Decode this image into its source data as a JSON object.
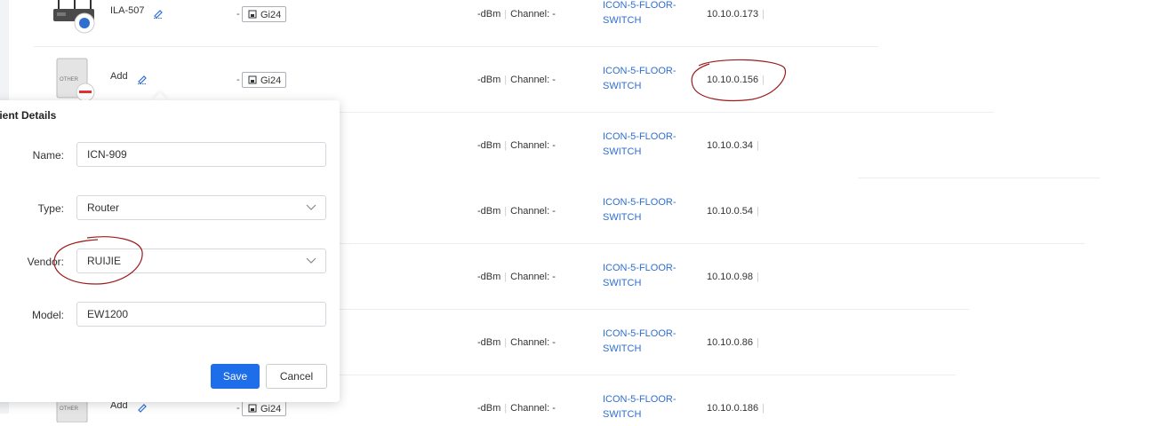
{
  "rows": [
    {
      "device_type": "router",
      "name": "ILA-507",
      "port": "Gi24",
      "signal": "-dBm",
      "channel": "Channel: -",
      "switch": "ICON-5-FLOOR-SWITCH",
      "ip": "10.10.0.173"
    },
    {
      "device_type": "other",
      "device_label": "OTHER",
      "name": "Add",
      "port": "Gi24",
      "signal": "-dBm",
      "channel": "Channel: -",
      "switch": "ICON-5-FLOOR-SWITCH",
      "ip": "10.10.0.156"
    },
    {
      "signal": "-dBm",
      "channel": "Channel: -",
      "switch": "ICON-5-FLOOR-SWITCH",
      "ip": "10.10.0.34"
    },
    {
      "signal": "-dBm",
      "channel": "Channel: -",
      "switch": "ICON-5-FLOOR-SWITCH",
      "ip": "10.10.0.54"
    },
    {
      "signal": "-dBm",
      "channel": "Channel: -",
      "switch": "ICON-5-FLOOR-SWITCH",
      "ip": "10.10.0.98"
    },
    {
      "signal": "-dBm",
      "channel": "Channel: -",
      "switch": "ICON-5-FLOOR-SWITCH",
      "ip": "10.10.0.86"
    },
    {
      "device_type": "other",
      "device_label": "OTHER",
      "name": "Add",
      "port": "Gi24",
      "signal": "-dBm",
      "channel": "Channel: -",
      "switch": "ICON-5-FLOOR-SWITCH",
      "ip": "10.10.0.186"
    }
  ],
  "separator": "|",
  "port_dash": "-",
  "popover": {
    "title": "lient Details",
    "fields": [
      {
        "label": "Name:",
        "value": "ICN-909",
        "kind": "input"
      },
      {
        "label": "Type:",
        "value": "Router",
        "kind": "select"
      },
      {
        "label": "Vendor:",
        "value": "RUIJIE",
        "kind": "select"
      },
      {
        "label": "Model:",
        "value": "EW1200",
        "kind": "input"
      }
    ],
    "save_label": "Save",
    "cancel_label": "Cancel"
  },
  "colors": {
    "accent": "#1d6ee8",
    "link": "#2f6fd0",
    "annotation": "#9b1b1b"
  },
  "icons": [
    "edit-icon",
    "port-icon",
    "chevron-down-icon",
    "device-image"
  ]
}
